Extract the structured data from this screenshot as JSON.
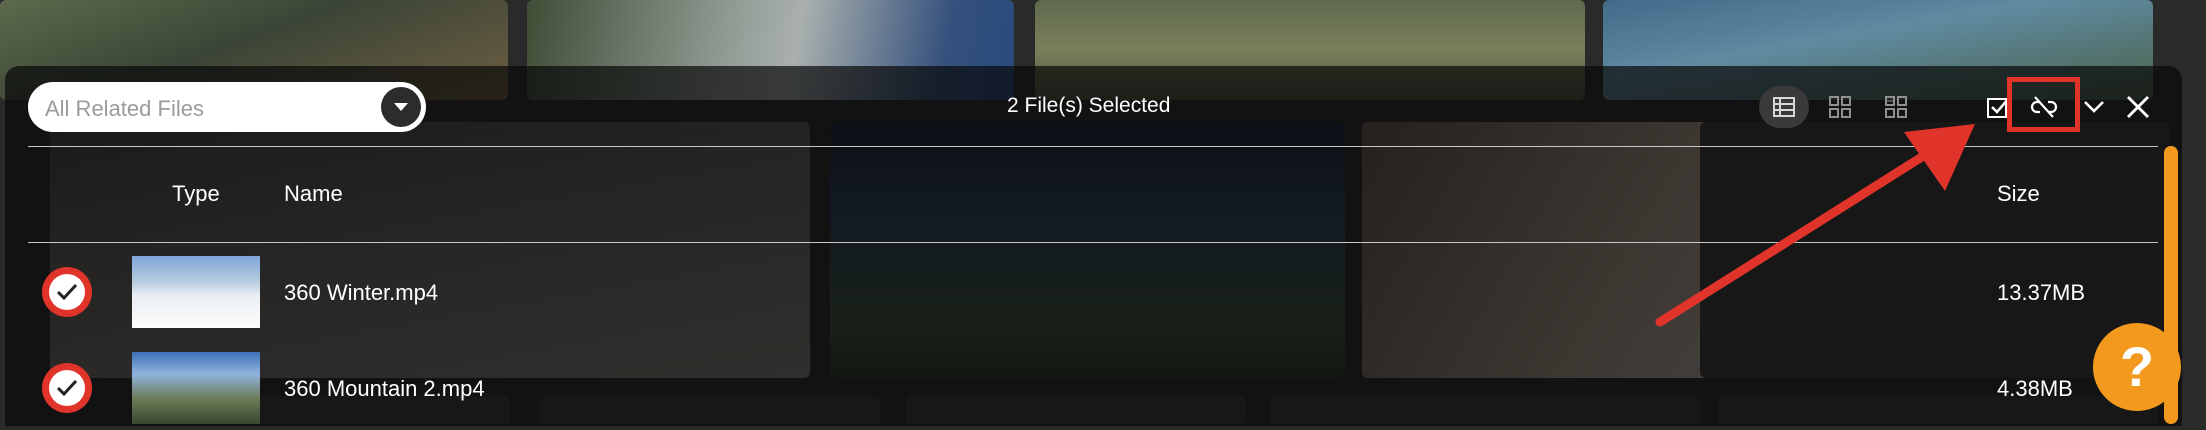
{
  "toolbar": {
    "filter_placeholder": "All Related Files",
    "selection_title": "2 File(s) Selected",
    "icons": [
      "list-view-icon",
      "grid-view-icon",
      "large-grid-view-icon",
      "select-all-icon",
      "unlink-icon",
      "chevron-down-icon",
      "close-icon"
    ]
  },
  "columns": {
    "type": "Type",
    "name": "Name",
    "size": "Size"
  },
  "files": [
    {
      "name": "360 Winter.mp4",
      "size": "13.37MB",
      "selected": true
    },
    {
      "name": "360 Mountain 2.mp4",
      "size": "4.38MB",
      "selected": true
    }
  ],
  "help": {
    "label": "?"
  },
  "colors": {
    "accent_orange": "#f39a1e",
    "highlight_red": "#e0342a",
    "panel_bg": "#080808"
  }
}
